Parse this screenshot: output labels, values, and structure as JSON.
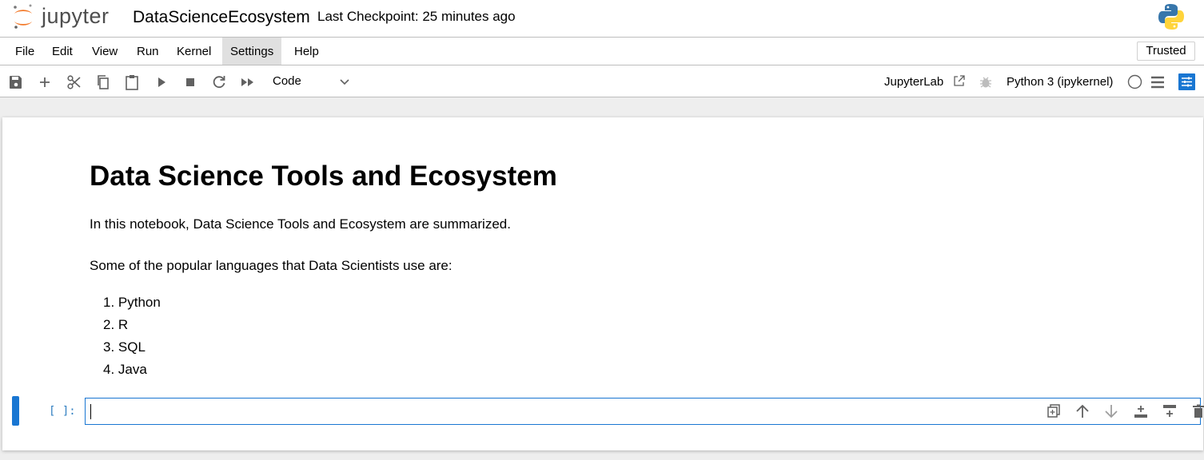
{
  "header": {
    "logo_text": "jupyter",
    "notebook_title": "DataScienceEcosystem",
    "checkpoint": "Last Checkpoint: 25 minutes ago"
  },
  "menu": {
    "items": [
      "File",
      "Edit",
      "View",
      "Run",
      "Kernel",
      "Settings",
      "Help"
    ],
    "active": "Settings",
    "trusted": "Trusted"
  },
  "toolbar": {
    "icons": [
      "save-icon",
      "add-cell-icon",
      "cut-icon",
      "copy-icon",
      "paste-icon",
      "run-icon",
      "stop-icon",
      "restart-icon",
      "run-all-icon"
    ],
    "cell_type": "Code",
    "jupyterlab_link": "JupyterLab",
    "kernel_name": "Python 3 (ipykernel)",
    "kernel_status": "idle"
  },
  "notebook": {
    "heading": "Data Science Tools and Ecosystem",
    "intro": "In this notebook, Data Science Tools and Ecosystem are summarized.",
    "languages_intro": "Some of the popular languages that Data Scientists use are:",
    "languages": [
      "1. Python",
      "2. R",
      "3. SQL",
      "4. Java"
    ],
    "code_cell": {
      "prompt": "[ ]:",
      "value": "",
      "tools": [
        "duplicate-icon",
        "move-up-icon",
        "move-down-icon",
        "insert-above-icon",
        "insert-below-icon",
        "delete-icon"
      ]
    }
  },
  "colors": {
    "accent": "#1976d2",
    "prompt": "#307fc1",
    "jupyter_orange": "#f37726"
  }
}
